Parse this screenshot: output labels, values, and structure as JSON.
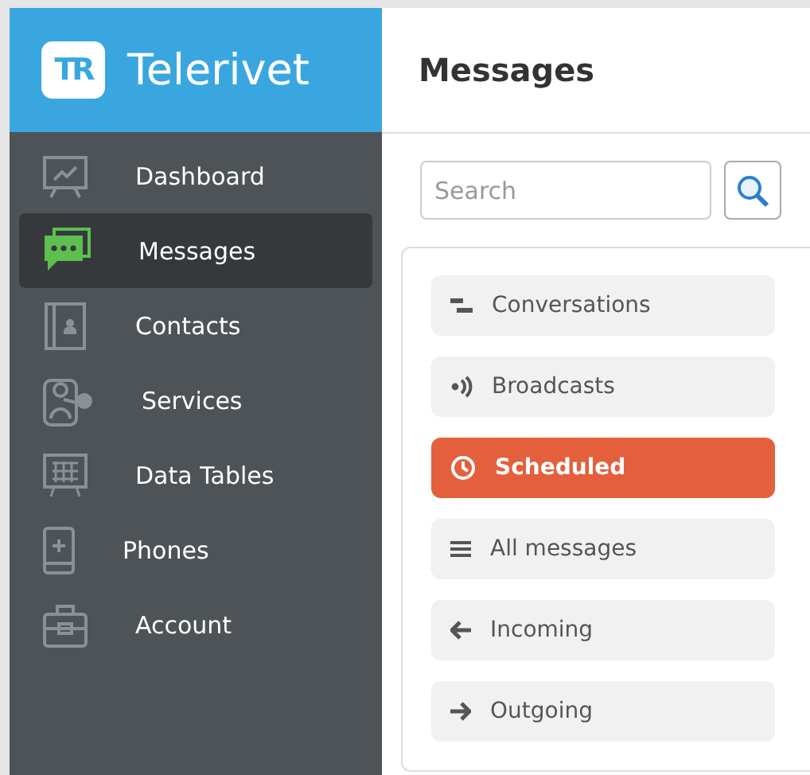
{
  "brand": {
    "logo": "TR",
    "name": "Telerivet"
  },
  "sidebar": {
    "items": [
      {
        "kind": "dashboard",
        "label": "Dashboard",
        "selected": false
      },
      {
        "kind": "messages",
        "label": "Messages",
        "selected": true
      },
      {
        "kind": "contacts",
        "label": "Contacts",
        "selected": false
      },
      {
        "kind": "services",
        "label": "Services",
        "selected": false
      },
      {
        "kind": "tables",
        "label": "Data Tables",
        "selected": false
      },
      {
        "kind": "phones",
        "label": "Phones",
        "selected": false
      },
      {
        "kind": "account",
        "label": "Account",
        "selected": false
      }
    ]
  },
  "page_title": "Messages",
  "search": {
    "placeholder": "Search"
  },
  "filters": [
    {
      "kind": "conversations",
      "label": "Conversations",
      "selected": false
    },
    {
      "kind": "broadcasts",
      "label": "Broadcasts",
      "selected": false
    },
    {
      "kind": "scheduled",
      "label": "Scheduled",
      "selected": true
    },
    {
      "kind": "all",
      "label": "All messages",
      "selected": false
    },
    {
      "kind": "incoming",
      "label": "Incoming",
      "selected": false
    },
    {
      "kind": "outgoing",
      "label": "Outgoing",
      "selected": false
    }
  ]
}
